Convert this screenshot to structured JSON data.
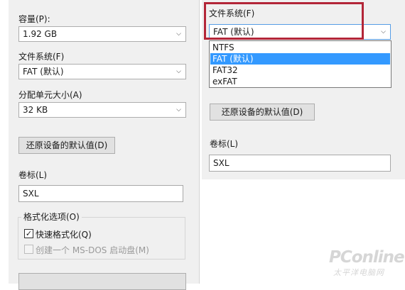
{
  "left_panel": {
    "capacity_label": "容量(P):",
    "capacity_value": "1.92 GB",
    "filesystem_label": "文件系统(F)",
    "filesystem_value": "FAT (默认)",
    "alloc_label": "分配单元大小(A)",
    "alloc_value": "32 KB",
    "restore_button": "还原设备的默认值(D)",
    "volume_label": "卷标(L)",
    "volume_value": "SXL",
    "format_options_title": "格式化选项(O)",
    "quick_format_label": "快速格式化(Q)",
    "quick_format_checked": true,
    "msdos_label": "创建一个 MS-DOS 启动盘(M)",
    "msdos_checked": false
  },
  "right_panel": {
    "filesystem_label": "文件系统(F)",
    "filesystem_value": "FAT (默认)",
    "dropdown_options": [
      "NTFS",
      "FAT (默认)",
      "FAT32",
      "exFAT"
    ],
    "selected_option": "FAT (默认)",
    "restore_button": "还原设备的默认值(D)",
    "volume_label": "卷标(L)",
    "volume_value": "SXL"
  },
  "watermark": {
    "brand": "PConline",
    "sub": "太平洋电脑网"
  },
  "colors": {
    "highlight": "#b32638",
    "selected_option_bg": "#3399ff",
    "panel_bg": "#f0f0f0"
  },
  "icons": {
    "dropdown": "chevron-down-icon",
    "check": "checkmark-icon"
  }
}
